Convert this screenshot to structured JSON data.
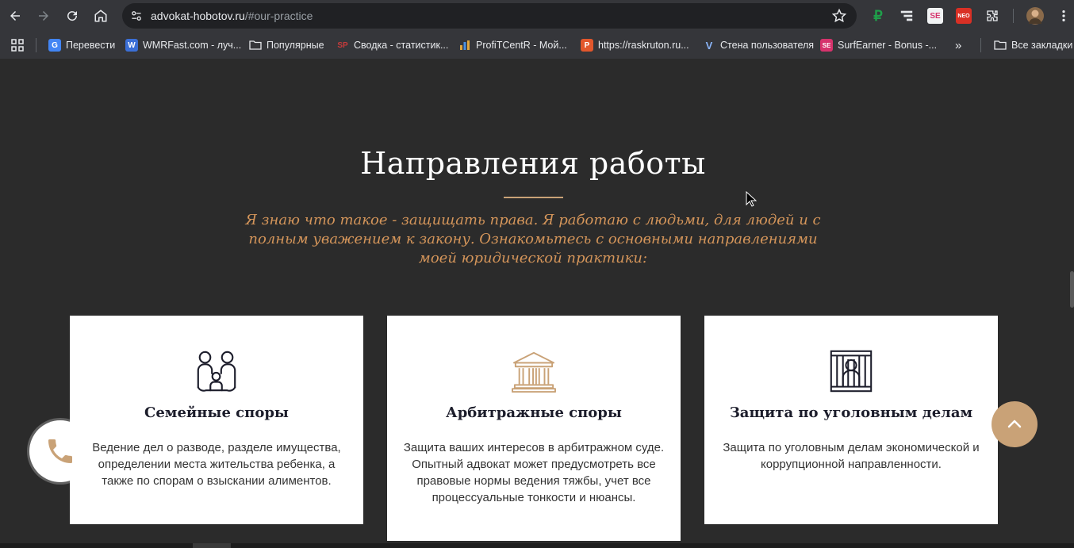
{
  "browser": {
    "url_host": "advokat-hobotov.ru",
    "url_path": "/#our-practice",
    "bookmarks": [
      {
        "label": "Перевести",
        "icon": "google-translate-icon",
        "color": "#4285f4"
      },
      {
        "label": "WMRFast.com - луч...",
        "icon": "wmrfast-icon",
        "color": "#3b6fd6"
      },
      {
        "label": "Популярные",
        "icon": "folder-icon",
        "color": ""
      },
      {
        "label": "Сводка - статистик...",
        "icon": "sp-icon",
        "color": "#c53b3b"
      },
      {
        "label": "ProfiTCentR - Мой...",
        "icon": "chart-icon",
        "color": "#e1a63c"
      },
      {
        "label": "https://raskruton.ru...",
        "icon": "raskruton-icon",
        "color": "#e2572c"
      },
      {
        "label": "Стена пользователя",
        "icon": "v-icon",
        "color": "#8ab4f8"
      },
      {
        "label": "SurfEarner - Bonus -...",
        "icon": "surfearner-icon",
        "color": "#d6336c"
      }
    ],
    "all_bookmarks": "Все закладки"
  },
  "page": {
    "section_title": "Направления работы",
    "lead_text": "Я знаю что такое -  защищать права. Я работаю с людьми, для людей и с полным уважением к закону. Ознакомьтесь с основными направлениями моей юридической практики:",
    "accent_color": "#c9a277",
    "cards": [
      {
        "icon": "family-icon",
        "title": "Семейные споры",
        "text": "Ведение дел о разводе, разделе имущества, определении места жительства ребенка, а также по спорам о взыскании алиментов."
      },
      {
        "icon": "courthouse-icon",
        "title": "Арбитражные споры",
        "text": "Защита ваших интересов в арбитражном суде. Опытный адвокат может предусмотреть все правовые нормы ведения тяжбы, учет все процессуальные тонкости и нюансы."
      },
      {
        "icon": "prison-bars-icon",
        "title": "Защита по уголовным делам",
        "text": "Защита по уголовным делам экономической и коррупционной направленности."
      }
    ]
  }
}
